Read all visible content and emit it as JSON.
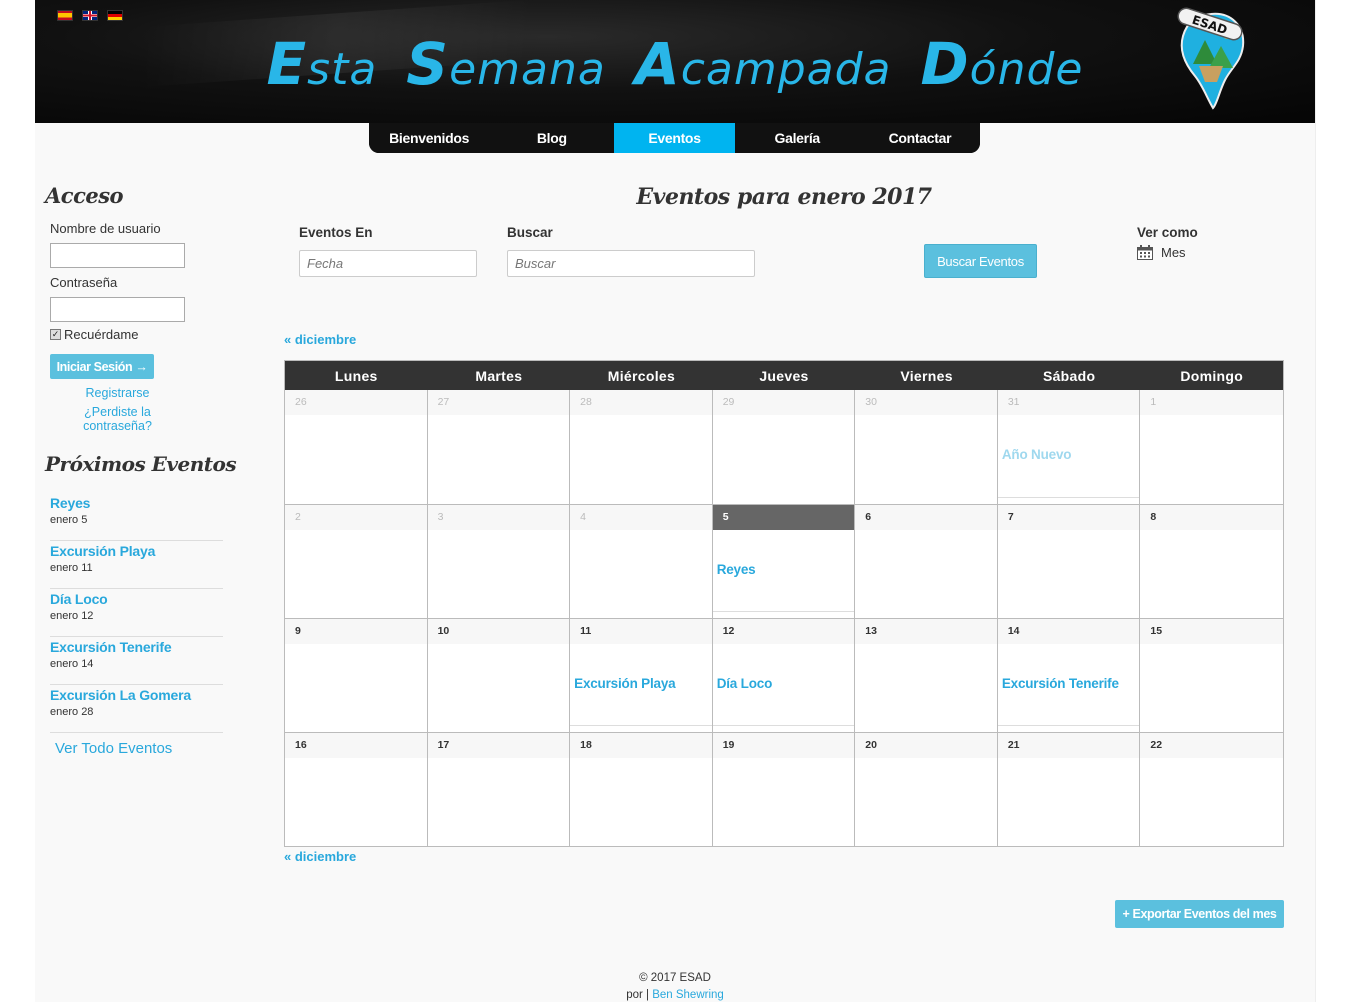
{
  "header": {
    "title_parts": [
      {
        "cap": "E",
        "rest": "sta"
      },
      {
        "cap": "S",
        "rest": "emana"
      },
      {
        "cap": "A",
        "rest": "campada"
      },
      {
        "cap": "D",
        "rest": "ónde"
      }
    ],
    "logo_text": "ESAD",
    "flags": [
      "spain-flag-icon",
      "uk-flag-icon",
      "germany-flag-icon"
    ]
  },
  "nav": {
    "items": [
      {
        "label": "Bienvenidos",
        "active": false
      },
      {
        "label": "Blog",
        "active": false
      },
      {
        "label": "Eventos",
        "active": true
      },
      {
        "label": "Galería",
        "active": false
      },
      {
        "label": "Contactar",
        "active": false
      }
    ]
  },
  "sidebar": {
    "login_title": "Acceso",
    "username_label": "Nombre de usuario",
    "password_label": "Contraseña",
    "remember_label": "Recuérdame",
    "remember_checked": true,
    "login_button": "Iniciar Sesión →",
    "register_link": "Registrarse",
    "forgot_link": "¿Perdiste la contraseña?",
    "upcoming_title": "Próximos Eventos",
    "upcoming": [
      {
        "name": "Reyes",
        "date": "enero 5"
      },
      {
        "name": "Excursión Playa",
        "date": "enero 11"
      },
      {
        "name": "Día Loco",
        "date": "enero 12"
      },
      {
        "name": "Excursión Tenerife",
        "date": "enero 14"
      },
      {
        "name": "Excursión La Gomera",
        "date": "enero 28"
      }
    ],
    "view_all": "Ver Todo Eventos"
  },
  "main": {
    "title": "Eventos para enero 2017",
    "filters": {
      "events_in_label": "Eventos En",
      "events_in_placeholder": "Fecha",
      "search_label": "Buscar",
      "search_placeholder": "Buscar",
      "search_button": "Buscar Eventos",
      "view_as_label": "Ver como",
      "view_as_value": "Mes"
    },
    "prev_month_top": "« diciembre",
    "prev_month_bottom": "« diciembre",
    "weekdays": [
      "Lunes",
      "Martes",
      "Miércoles",
      "Jueves",
      "Viernes",
      "Sábado",
      "Domingo"
    ],
    "weeks": [
      [
        {
          "d": "26",
          "past": true
        },
        {
          "d": "27",
          "past": true
        },
        {
          "d": "28",
          "past": true
        },
        {
          "d": "29",
          "past": true
        },
        {
          "d": "30",
          "past": true
        },
        {
          "d": "31",
          "past": true,
          "event": "Año Nuevo"
        },
        {
          "d": "1",
          "past": true
        }
      ],
      [
        {
          "d": "2",
          "past": true
        },
        {
          "d": "3",
          "past": true
        },
        {
          "d": "4",
          "past": true
        },
        {
          "d": "5",
          "today": true,
          "event": "Reyes"
        },
        {
          "d": "6"
        },
        {
          "d": "7"
        },
        {
          "d": "8"
        }
      ],
      [
        {
          "d": "9"
        },
        {
          "d": "10"
        },
        {
          "d": "11",
          "event": "Excursión Playa"
        },
        {
          "d": "12",
          "event": "Día Loco"
        },
        {
          "d": "13"
        },
        {
          "d": "14",
          "event": "Excursión Tenerife"
        },
        {
          "d": "15"
        }
      ],
      [
        {
          "d": "16"
        },
        {
          "d": "17"
        },
        {
          "d": "18"
        },
        {
          "d": "19"
        },
        {
          "d": "20"
        },
        {
          "d": "21"
        },
        {
          "d": "22"
        }
      ]
    ],
    "export_button": "+ Exportar Eventos del mes"
  },
  "footer": {
    "copyright": "© 2017 ESAD",
    "by_prefix": "por |",
    "author": "Ben Shewring"
  },
  "colors": {
    "accent": "#29b6e8",
    "button": "#5bc0de",
    "nav_active": "#00b4f0",
    "header_bg": "#0a0a0a",
    "calendar_head": "#333333"
  }
}
